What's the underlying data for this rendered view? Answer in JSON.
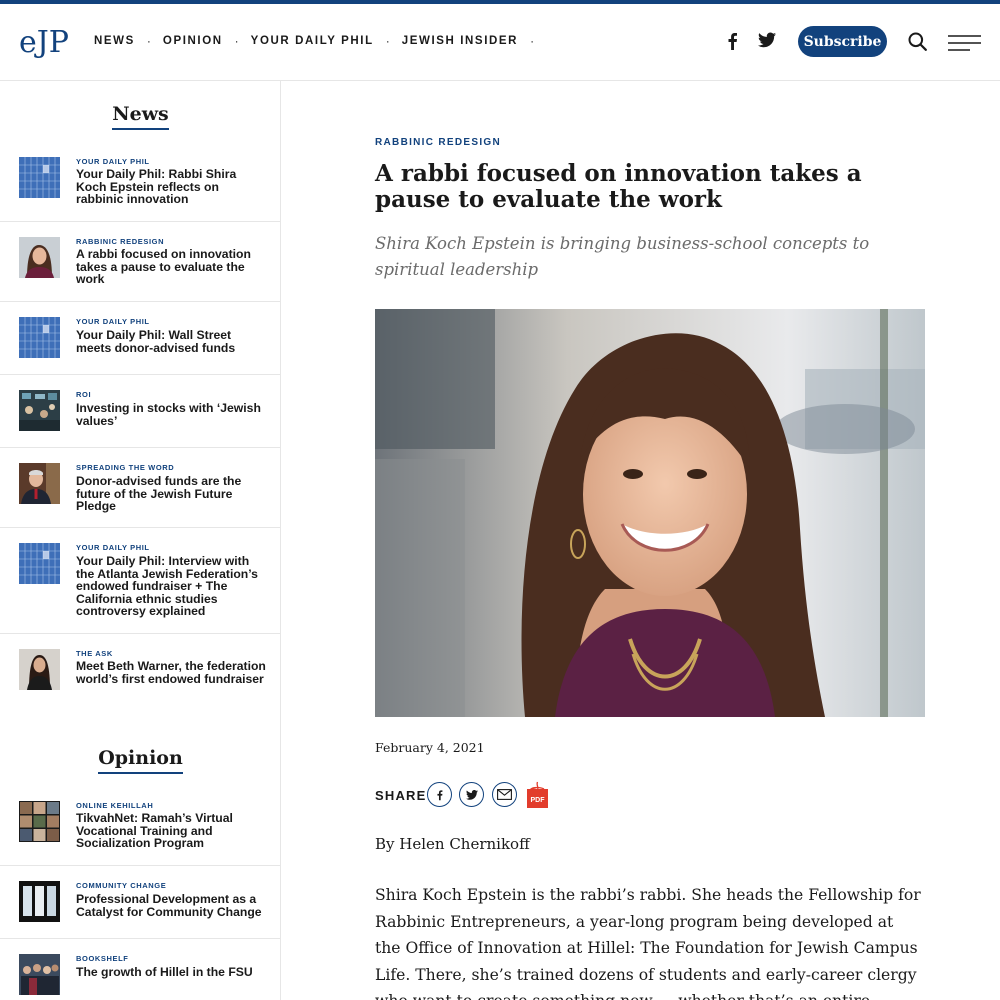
{
  "header": {
    "logo_text": "eJP",
    "nav": [
      "NEWS",
      "OPINION",
      "YOUR DAILY PHIL",
      "JEWISH INSIDER"
    ],
    "subscribe_label": "Subscribe",
    "icons": [
      "facebook-icon",
      "twitter-icon",
      "search-icon",
      "menu-icon"
    ]
  },
  "sidebar": {
    "news_title": "News",
    "news_items": [
      {
        "kicker": "YOUR DAILY PHIL",
        "headline": "Your Daily Phil: Rabbi Shira Koch Epstein reflects on rabbinic innovation",
        "thumb": "calendar"
      },
      {
        "kicker": "RABBINIC REDESIGN",
        "headline": "A rabbi focused on innovation takes a pause to evaluate the work",
        "thumb": "portrait"
      },
      {
        "kicker": "YOUR DAILY PHIL",
        "headline": "Your Daily Phil: Wall Street meets donor-advised funds",
        "thumb": "calendar"
      },
      {
        "kicker": "ROI",
        "headline": "Investing in stocks with ‘Jewish values’",
        "thumb": "trading-floor"
      },
      {
        "kicker": "SPREADING THE WORD",
        "headline": "Donor-advised funds are the future of the Jewish Future Pledge",
        "thumb": "portrait-man"
      },
      {
        "kicker": "YOUR DAILY PHIL",
        "headline": "Your Daily Phil: Interview with the Atlanta Jewish Federation’s endowed fundraiser + The California ethnic studies controversy explained",
        "thumb": "calendar"
      },
      {
        "kicker": "THE ASK",
        "headline": "Meet Beth Warner, the federation world’s first endowed fundraiser",
        "thumb": "portrait-woman"
      }
    ],
    "opinion_title": "Opinion",
    "opinion_items": [
      {
        "kicker": "ONLINE KEHILLAH",
        "headline": "TikvahNet: Ramah’s Virtual Vocational Training and Socialization Program",
        "thumb": "video-grid"
      },
      {
        "kicker": "COMMUNITY CHANGE",
        "headline": "Professional Development as a Catalyst for Community Change",
        "thumb": "windows"
      },
      {
        "kicker": "BOOKSHELF",
        "headline": "The growth of Hillel in the FSU",
        "thumb": "group"
      }
    ]
  },
  "article": {
    "kicker": "RABBINIC REDESIGN",
    "headline": "A rabbi focused on innovation takes a pause to evaluate the work",
    "subhead": "Shira Koch Epstein is bringing business-school concepts to spiritual leadership",
    "date": "February 4, 2021",
    "share_label": "SHARE",
    "pdf_label": "PDF",
    "byline": "By Helen Chernikoff",
    "body": "Shira Koch Epstein is the rabbi’s rabbi. She heads the Fellowship for Rabbinic Entrepreneurs, a year-long program being developed at the Office of Innovation at Hillel: The Foundation for Jewish Campus Life. There, she’s trained dozens of students and early-career clergy who want to create something new — whether that’s an entire community or a major new project in an existing one. When the"
  },
  "colors": {
    "brand": "#12427d",
    "text": "#1a1a1a",
    "muted": "#6b6b6b",
    "divider": "#e6e6e6"
  }
}
